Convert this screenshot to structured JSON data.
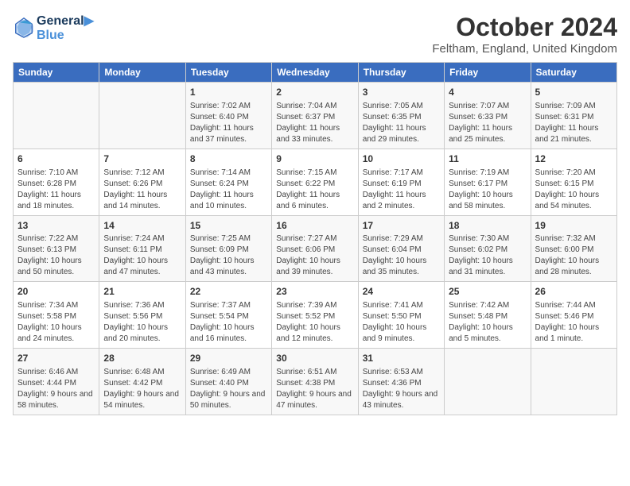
{
  "header": {
    "logo_line1": "General",
    "logo_line2": "Blue",
    "month_title": "October 2024",
    "location": "Feltham, England, United Kingdom"
  },
  "days_of_week": [
    "Sunday",
    "Monday",
    "Tuesday",
    "Wednesday",
    "Thursday",
    "Friday",
    "Saturday"
  ],
  "weeks": [
    [
      {
        "day": "",
        "info": ""
      },
      {
        "day": "",
        "info": ""
      },
      {
        "day": "1",
        "info": "Sunrise: 7:02 AM\nSunset: 6:40 PM\nDaylight: 11 hours and 37 minutes."
      },
      {
        "day": "2",
        "info": "Sunrise: 7:04 AM\nSunset: 6:37 PM\nDaylight: 11 hours and 33 minutes."
      },
      {
        "day": "3",
        "info": "Sunrise: 7:05 AM\nSunset: 6:35 PM\nDaylight: 11 hours and 29 minutes."
      },
      {
        "day": "4",
        "info": "Sunrise: 7:07 AM\nSunset: 6:33 PM\nDaylight: 11 hours and 25 minutes."
      },
      {
        "day": "5",
        "info": "Sunrise: 7:09 AM\nSunset: 6:31 PM\nDaylight: 11 hours and 21 minutes."
      }
    ],
    [
      {
        "day": "6",
        "info": "Sunrise: 7:10 AM\nSunset: 6:28 PM\nDaylight: 11 hours and 18 minutes."
      },
      {
        "day": "7",
        "info": "Sunrise: 7:12 AM\nSunset: 6:26 PM\nDaylight: 11 hours and 14 minutes."
      },
      {
        "day": "8",
        "info": "Sunrise: 7:14 AM\nSunset: 6:24 PM\nDaylight: 11 hours and 10 minutes."
      },
      {
        "day": "9",
        "info": "Sunrise: 7:15 AM\nSunset: 6:22 PM\nDaylight: 11 hours and 6 minutes."
      },
      {
        "day": "10",
        "info": "Sunrise: 7:17 AM\nSunset: 6:19 PM\nDaylight: 11 hours and 2 minutes."
      },
      {
        "day": "11",
        "info": "Sunrise: 7:19 AM\nSunset: 6:17 PM\nDaylight: 10 hours and 58 minutes."
      },
      {
        "day": "12",
        "info": "Sunrise: 7:20 AM\nSunset: 6:15 PM\nDaylight: 10 hours and 54 minutes."
      }
    ],
    [
      {
        "day": "13",
        "info": "Sunrise: 7:22 AM\nSunset: 6:13 PM\nDaylight: 10 hours and 50 minutes."
      },
      {
        "day": "14",
        "info": "Sunrise: 7:24 AM\nSunset: 6:11 PM\nDaylight: 10 hours and 47 minutes."
      },
      {
        "day": "15",
        "info": "Sunrise: 7:25 AM\nSunset: 6:09 PM\nDaylight: 10 hours and 43 minutes."
      },
      {
        "day": "16",
        "info": "Sunrise: 7:27 AM\nSunset: 6:06 PM\nDaylight: 10 hours and 39 minutes."
      },
      {
        "day": "17",
        "info": "Sunrise: 7:29 AM\nSunset: 6:04 PM\nDaylight: 10 hours and 35 minutes."
      },
      {
        "day": "18",
        "info": "Sunrise: 7:30 AM\nSunset: 6:02 PM\nDaylight: 10 hours and 31 minutes."
      },
      {
        "day": "19",
        "info": "Sunrise: 7:32 AM\nSunset: 6:00 PM\nDaylight: 10 hours and 28 minutes."
      }
    ],
    [
      {
        "day": "20",
        "info": "Sunrise: 7:34 AM\nSunset: 5:58 PM\nDaylight: 10 hours and 24 minutes."
      },
      {
        "day": "21",
        "info": "Sunrise: 7:36 AM\nSunset: 5:56 PM\nDaylight: 10 hours and 20 minutes."
      },
      {
        "day": "22",
        "info": "Sunrise: 7:37 AM\nSunset: 5:54 PM\nDaylight: 10 hours and 16 minutes."
      },
      {
        "day": "23",
        "info": "Sunrise: 7:39 AM\nSunset: 5:52 PM\nDaylight: 10 hours and 12 minutes."
      },
      {
        "day": "24",
        "info": "Sunrise: 7:41 AM\nSunset: 5:50 PM\nDaylight: 10 hours and 9 minutes."
      },
      {
        "day": "25",
        "info": "Sunrise: 7:42 AM\nSunset: 5:48 PM\nDaylight: 10 hours and 5 minutes."
      },
      {
        "day": "26",
        "info": "Sunrise: 7:44 AM\nSunset: 5:46 PM\nDaylight: 10 hours and 1 minute."
      }
    ],
    [
      {
        "day": "27",
        "info": "Sunrise: 6:46 AM\nSunset: 4:44 PM\nDaylight: 9 hours and 58 minutes."
      },
      {
        "day": "28",
        "info": "Sunrise: 6:48 AM\nSunset: 4:42 PM\nDaylight: 9 hours and 54 minutes."
      },
      {
        "day": "29",
        "info": "Sunrise: 6:49 AM\nSunset: 4:40 PM\nDaylight: 9 hours and 50 minutes."
      },
      {
        "day": "30",
        "info": "Sunrise: 6:51 AM\nSunset: 4:38 PM\nDaylight: 9 hours and 47 minutes."
      },
      {
        "day": "31",
        "info": "Sunrise: 6:53 AM\nSunset: 4:36 PM\nDaylight: 9 hours and 43 minutes."
      },
      {
        "day": "",
        "info": ""
      },
      {
        "day": "",
        "info": ""
      }
    ]
  ]
}
